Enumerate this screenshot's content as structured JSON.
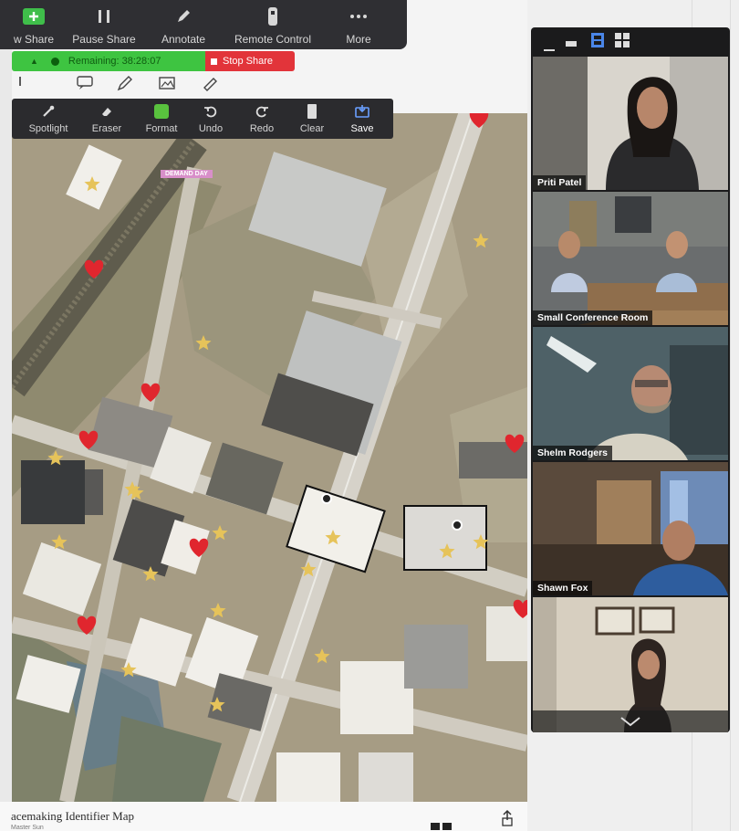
{
  "share_toolbar": {
    "buttons": [
      {
        "label": "w Share",
        "icon": "new-share-icon"
      },
      {
        "label": "Pause Share",
        "icon": "pause-icon"
      },
      {
        "label": "Annotate",
        "icon": "pencil-icon"
      },
      {
        "label": "Remote Control",
        "icon": "remote-control-icon"
      },
      {
        "label": "More",
        "icon": "more-dots-icon"
      }
    ]
  },
  "status_bar": {
    "remaining_text": "Remaining: 38:28:07",
    "stop_share_label": "Stop Share"
  },
  "annotation_toolbar": {
    "tools": [
      {
        "label": "Spotlight",
        "icon": "spotlight-icon"
      },
      {
        "label": "Eraser",
        "icon": "eraser-icon"
      },
      {
        "label": "Format",
        "icon": "format-icon"
      },
      {
        "label": "Undo",
        "icon": "undo-icon"
      },
      {
        "label": "Redo",
        "icon": "redo-icon"
      },
      {
        "label": "Clear",
        "icon": "clear-icon"
      },
      {
        "label": "Save",
        "icon": "save-icon"
      }
    ],
    "active_tool": "Save"
  },
  "map": {
    "label_tag": "DEMAND DAY"
  },
  "document": {
    "title": "acemaking Identifier Map",
    "subtitle": "Master Sun"
  },
  "video_panel": {
    "participants": [
      {
        "name": "Priti Patel",
        "active_speaker": true
      },
      {
        "name": "Small Conference Room",
        "active_speaker": false
      },
      {
        "name": "Shelm Rodgers",
        "active_speaker": false
      },
      {
        "name": "Shawn Fox",
        "active_speaker": false
      },
      {
        "name": "",
        "active_speaker": false
      }
    ]
  },
  "colors": {
    "toolbar_bg": "#2f2f33",
    "remaining_green": "#3ec441",
    "stop_share_red": "#e2343a",
    "heart_red": "#e0262e",
    "star_yellow": "#e6c35a",
    "active_speaker_border": "#c9c05a"
  }
}
